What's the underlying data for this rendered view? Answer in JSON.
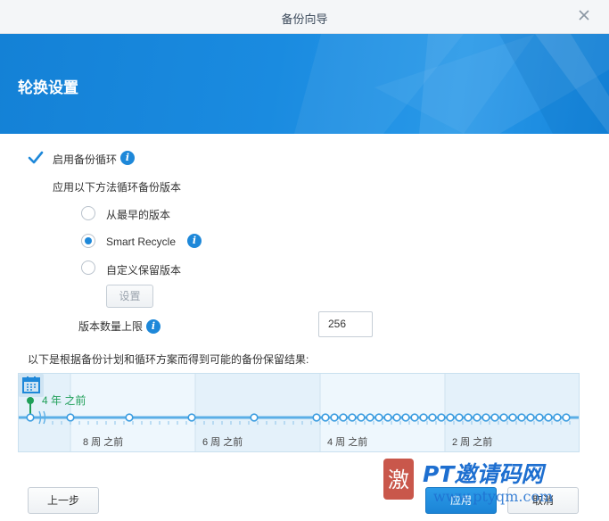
{
  "window": {
    "title": "备份向导"
  },
  "banner": {
    "heading": "轮换设置"
  },
  "rotation": {
    "enable_label": "启用备份循环",
    "enabled": true,
    "method_label": "应用以下方法循环备份版本",
    "options": [
      {
        "label": "从最早的版本",
        "selected": false
      },
      {
        "label": "Smart Recycle",
        "selected": true
      },
      {
        "label": "自定义保留版本",
        "selected": false
      }
    ],
    "settings_button": "设置",
    "max_versions_label": "版本数量上限",
    "max_versions_value": "256"
  },
  "timeline": {
    "caption": "以下是根据备份计划和循环方案而得到可能的备份保留结果:",
    "start_label": "4 年 之前",
    "week_labels": [
      "8 周 之前",
      "6 周 之前",
      "4 周 之前",
      "2 周 之前"
    ]
  },
  "footer": {
    "back_button": "上一步",
    "apply_button": "应用",
    "cancel_button": "取消"
  },
  "watermark": {
    "title": "PT邀请码网",
    "url": "www.ptyqm.com"
  },
  "colors": {
    "accent": "#1e88d9",
    "banner": "#1a8be0",
    "timeline_green": "#1f9f58"
  }
}
